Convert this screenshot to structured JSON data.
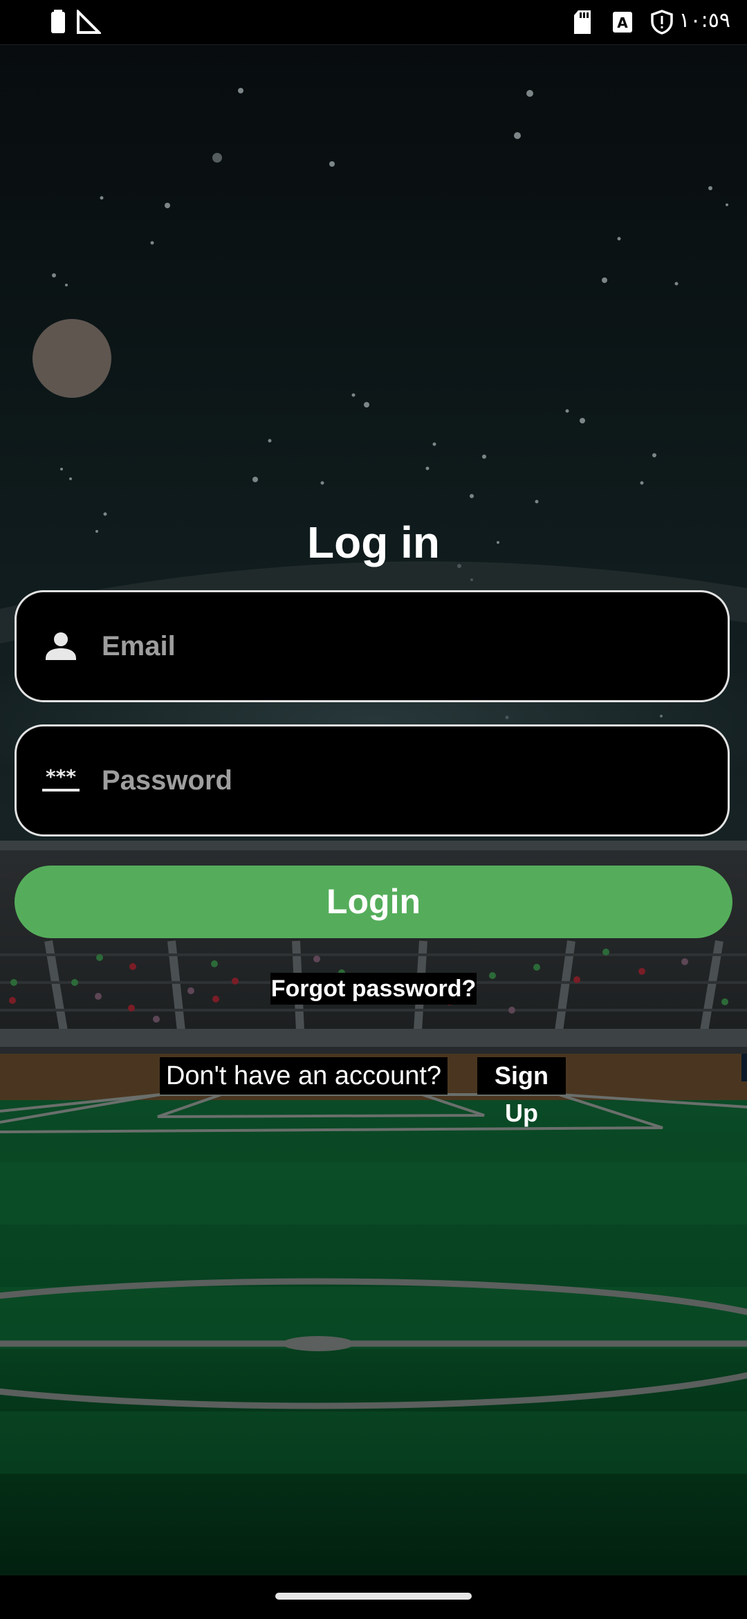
{
  "status_bar": {
    "time": "١٠:٥٩",
    "icons": [
      "battery-icon",
      "signal-icon",
      "sd-card-icon",
      "keyboard-a-icon",
      "shield-icon"
    ]
  },
  "login": {
    "title": "Log in",
    "email": {
      "placeholder": "Email",
      "value": "",
      "icon": "person-icon"
    },
    "password": {
      "placeholder": "Password",
      "value": "",
      "icon": "password-asterisks-icon"
    },
    "login_button": "Login",
    "forgot_password": "Forgot password?",
    "no_account": "Don't have an account?",
    "sign_up": "Sign Up"
  },
  "colors": {
    "accent": "#55ad5b",
    "field_border": "#e2e2e2",
    "placeholder": "#9e9e9e"
  }
}
